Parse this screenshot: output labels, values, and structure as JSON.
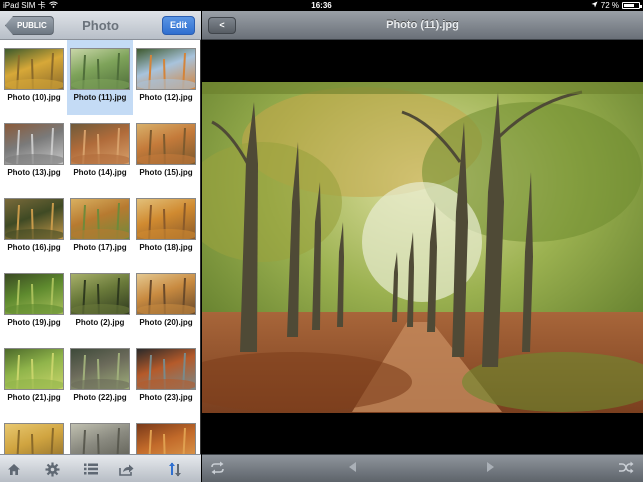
{
  "status_bar": {
    "carrier": "iPad SIM 卡",
    "time": "16:36",
    "battery_text": "72 %",
    "battery_level": 0.72
  },
  "left_panel": {
    "back_label": "PUBLIC",
    "title": "Photo",
    "edit_label": "Edit",
    "photos": [
      {
        "name": "Photo (10).jpg",
        "selected": false
      },
      {
        "name": "Photo (11).jpg",
        "selected": true
      },
      {
        "name": "Photo (12).jpg",
        "selected": false
      },
      {
        "name": "Photo (13).jpg",
        "selected": false
      },
      {
        "name": "Photo (14).jpg",
        "selected": false
      },
      {
        "name": "Photo (15).jpg",
        "selected": false
      },
      {
        "name": "Photo (16).jpg",
        "selected": false
      },
      {
        "name": "Photo (17).jpg",
        "selected": false
      },
      {
        "name": "Photo (18).jpg",
        "selected": false
      },
      {
        "name": "Photo (19).jpg",
        "selected": false
      },
      {
        "name": "Photo (2).jpg",
        "selected": false
      },
      {
        "name": "Photo (20).jpg",
        "selected": false
      },
      {
        "name": "Photo (21).jpg",
        "selected": false
      },
      {
        "name": "Photo (22).jpg",
        "selected": false
      },
      {
        "name": "Photo (23).jpg",
        "selected": false
      },
      {
        "name": "",
        "selected": false
      },
      {
        "name": "",
        "selected": false
      },
      {
        "name": "",
        "selected": false
      }
    ],
    "toolbar_icons": [
      "home-icon",
      "gear-icon",
      "list-icon",
      "share-icon",
      "sort-icon"
    ]
  },
  "viewer": {
    "back_label": "<",
    "title": "Photo (11).jpg",
    "toolbar_icons": [
      "repeat-icon",
      "previous-icon",
      "next-icon",
      "shuffle-icon"
    ]
  },
  "colors": {
    "accent": "#2f6fd0",
    "selection": "#c4dbf5"
  }
}
